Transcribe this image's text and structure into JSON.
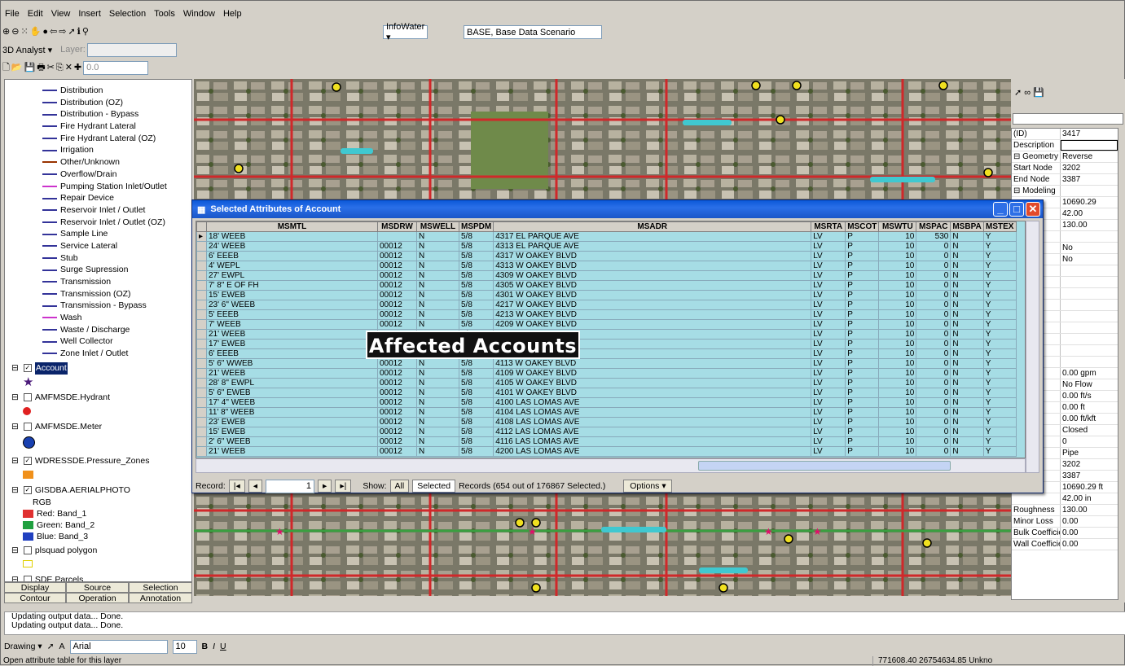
{
  "menu": [
    "File",
    "Edit",
    "View",
    "Insert",
    "Selection",
    "Tools",
    "Window",
    "Help"
  ],
  "toolbar": {
    "infowater": "InfoWater ▾",
    "scenario": "BASE, Base Data Scenario",
    "analyst": "3D Analyst ▾",
    "layer_label": "Layer:",
    "zoom_value": "0.0"
  },
  "toc": {
    "legend": [
      {
        "label": "Distribution",
        "color": "#333399"
      },
      {
        "label": "Distribution (OZ)",
        "color": "#333399"
      },
      {
        "label": "Distribution - Bypass",
        "color": "#333399"
      },
      {
        "label": "Fire Hydrant Lateral",
        "color": "#333399"
      },
      {
        "label": "Fire Hydrant Lateral (OZ)",
        "color": "#333399"
      },
      {
        "label": "Irrigation",
        "color": "#333399"
      },
      {
        "label": "Other/Unknown",
        "color": "#993300"
      },
      {
        "label": "Overflow/Drain",
        "color": "#333399"
      },
      {
        "label": "Pumping Station Inlet/Outlet",
        "color": "#cc33cc"
      },
      {
        "label": "Repair Device",
        "color": "#333399"
      },
      {
        "label": "Reservoir Inlet / Outlet",
        "color": "#333399"
      },
      {
        "label": "Reservoir Inlet / Outlet (OZ)",
        "color": "#333399"
      },
      {
        "label": "Sample Line",
        "color": "#333399"
      },
      {
        "label": "Service Lateral",
        "color": "#333399"
      },
      {
        "label": "Stub",
        "color": "#333399"
      },
      {
        "label": "Surge Supression",
        "color": "#333399"
      },
      {
        "label": "Transmission",
        "color": "#333399"
      },
      {
        "label": "Transmission (OZ)",
        "color": "#333399"
      },
      {
        "label": "Transmission - Bypass",
        "color": "#333399"
      },
      {
        "label": "Wash",
        "color": "#cc33cc"
      },
      {
        "label": "Waste / Discharge",
        "color": "#333399"
      },
      {
        "label": "Well Collector",
        "color": "#333399"
      },
      {
        "label": "Zone Inlet / Outlet",
        "color": "#333399"
      }
    ],
    "layers": {
      "account": "Account",
      "hydrant": "AMFMSDE.Hydrant",
      "meter": "AMFMSDE.Meter",
      "pressure": "WDRESSDE.Pressure_Zones",
      "aerial": "GISDBA.AERIALPHOTO",
      "rgb": "RGB",
      "red": "Red:   Band_1",
      "green": "Green: Band_2",
      "blue": "Blue:  Band_3",
      "plsquad": "plsquad polygon",
      "parcels": "SDE.Parcels"
    },
    "tabs": {
      "display": "Display",
      "source": "Source",
      "selection": "Selection",
      "contour": "Contour",
      "operation": "Operation",
      "annotation": "Annotation"
    }
  },
  "dialog": {
    "title": "Selected Attributes of Account",
    "columns": [
      "MSMTL",
      "MSDRW",
      "MSWELL",
      "MSPDM",
      "MSADR",
      "MSRTA",
      "MSCOT",
      "MSWTU",
      "MSPAC",
      "MSBPA",
      "MSTEX"
    ],
    "rows": [
      [
        "18' WEEB",
        "",
        "N",
        "5/8",
        "4317 EL PARQUE AVE",
        "LV",
        "P",
        "10",
        "530",
        "N",
        "Y"
      ],
      [
        "24' WEEB",
        "00012",
        "N",
        "5/8",
        "4313 EL PARQUE AVE",
        "LV",
        "P",
        "10",
        "0",
        "N",
        "Y"
      ],
      [
        "6' EEEB",
        "00012",
        "N",
        "5/8",
        "4317 W OAKEY BLVD",
        "LV",
        "P",
        "10",
        "0",
        "N",
        "Y"
      ],
      [
        "4' WEPL",
        "00012",
        "N",
        "5/8",
        "4313 W OAKEY BLVD",
        "LV",
        "P",
        "10",
        "0",
        "N",
        "Y"
      ],
      [
        "27' EWPL",
        "00012",
        "N",
        "5/8",
        "4309 W OAKEY BLVD",
        "LV",
        "P",
        "10",
        "0",
        "N",
        "Y"
      ],
      [
        "7' 8\" E OF FH",
        "00012",
        "N",
        "5/8",
        "4305 W OAKEY BLVD",
        "LV",
        "P",
        "10",
        "0",
        "N",
        "Y"
      ],
      [
        "15' EWEB",
        "00012",
        "N",
        "5/8",
        "4301 W OAKEY BLVD",
        "LV",
        "P",
        "10",
        "0",
        "N",
        "Y"
      ],
      [
        "23' 6\" WEEB",
        "00012",
        "N",
        "5/8",
        "4217 W OAKEY BLVD",
        "LV",
        "P",
        "10",
        "0",
        "N",
        "Y"
      ],
      [
        "5' EEEB",
        "00012",
        "N",
        "5/8",
        "4213 W OAKEY BLVD",
        "LV",
        "P",
        "10",
        "0",
        "N",
        "Y"
      ],
      [
        "7' WEEB",
        "00012",
        "N",
        "5/8",
        "4209 W OAKEY BLVD",
        "LV",
        "P",
        "10",
        "0",
        "N",
        "Y"
      ],
      [
        "21' WEEB",
        "00012",
        "N",
        "5/8",
        "",
        "LV",
        "P",
        "10",
        "0",
        "N",
        "Y"
      ],
      [
        "17' EWEB",
        "00012",
        "N",
        "5/8",
        "",
        "LV",
        "P",
        "10",
        "0",
        "N",
        "Y"
      ],
      [
        "6' EEEB",
        "00012",
        "N",
        "5/8",
        "",
        "LV",
        "P",
        "10",
        "0",
        "N",
        "Y"
      ],
      [
        "5' 6\" WWEB",
        "00012",
        "N",
        "5/8",
        "4113 W OAKEY BLVD",
        "LV",
        "P",
        "10",
        "0",
        "N",
        "Y"
      ],
      [
        "21' WEEB",
        "00012",
        "N",
        "5/8",
        "4109 W OAKEY BLVD",
        "LV",
        "P",
        "10",
        "0",
        "N",
        "Y"
      ],
      [
        "28' 8\" EWPL",
        "00012",
        "N",
        "5/8",
        "4105 W OAKEY BLVD",
        "LV",
        "P",
        "10",
        "0",
        "N",
        "Y"
      ],
      [
        "5' 6\" EWEB",
        "00012",
        "N",
        "5/8",
        "4101 W OAKEY BLVD",
        "LV",
        "P",
        "10",
        "0",
        "N",
        "Y"
      ],
      [
        "17' 4\" WEEB",
        "00012",
        "N",
        "5/8",
        "4100 LAS LOMAS AVE",
        "LV",
        "P",
        "10",
        "0",
        "N",
        "Y"
      ],
      [
        "11' 8\" WEEB",
        "00012",
        "N",
        "5/8",
        "4104 LAS LOMAS AVE",
        "LV",
        "P",
        "10",
        "0",
        "N",
        "Y"
      ],
      [
        "23' EWEB",
        "00012",
        "N",
        "5/8",
        "4108 LAS LOMAS AVE",
        "LV",
        "P",
        "10",
        "0",
        "N",
        "Y"
      ],
      [
        "15' EWEB",
        "00012",
        "N",
        "5/8",
        "4112 LAS LOMAS AVE",
        "LV",
        "P",
        "10",
        "0",
        "N",
        "Y"
      ],
      [
        "2' 6\" WEEB",
        "00012",
        "N",
        "5/8",
        "4116 LAS LOMAS AVE",
        "LV",
        "P",
        "10",
        "0",
        "N",
        "Y"
      ],
      [
        "21' WEEB",
        "00012",
        "N",
        "5/8",
        "4200 LAS LOMAS AVE",
        "LV",
        "P",
        "10",
        "0",
        "N",
        "Y"
      ]
    ],
    "record_label": "Record:",
    "record_value": "1",
    "show_label": "Show:",
    "all": "All",
    "selected": "Selected",
    "records_text": "Records  (654 out of 176867 Selected.)",
    "options": "Options ▾"
  },
  "overlay": "Affected Accounts",
  "props": [
    {
      "k": "(ID)",
      "v": "3417"
    },
    {
      "k": "Description",
      "v": ""
    },
    {
      "k": "⊟ Geometry",
      "v": "Reverse"
    },
    {
      "k": "Start Node",
      "v": "3202"
    },
    {
      "k": "End Node",
      "v": "3387"
    },
    {
      "k": "⊟ Modeling",
      "v": ""
    },
    {
      "k": "",
      "v": "10690.29"
    },
    {
      "k": "",
      "v": "42.00"
    },
    {
      "k": "ss",
      "v": "130.00"
    },
    {
      "k": "s",
      "v": ""
    },
    {
      "k": "alize",
      "v": "No"
    },
    {
      "k": "alve",
      "v": "No"
    },
    {
      "k": "etion",
      "v": ""
    },
    {
      "k": "n Ye",
      "v": ""
    },
    {
      "k": "nt Ye",
      "v": ""
    },
    {
      "k": "",
      "v": ""
    },
    {
      "k": "",
      "v": ""
    },
    {
      "k": "",
      "v": ""
    },
    {
      "k": "",
      "v": ""
    },
    {
      "k": "",
      "v": ""
    },
    {
      "k": "",
      "v": ""
    },
    {
      "k": "",
      "v": "0.00 gpm"
    },
    {
      "k": "ction",
      "v": "No Flow"
    },
    {
      "k": "",
      "v": "0.00 ft/s"
    },
    {
      "k": "",
      "v": "0.00 ft"
    },
    {
      "k": "",
      "v": "0.00 ft/kft"
    },
    {
      "k": "",
      "v": "Closed"
    },
    {
      "k": "erse",
      "v": "0"
    },
    {
      "k": "",
      "v": "Pipe"
    },
    {
      "k": "de",
      "v": "3202"
    },
    {
      "k": "",
      "v": "3387"
    },
    {
      "k": "",
      "v": "10690.29 ft"
    },
    {
      "k": "",
      "v": "42.00 in"
    },
    {
      "k": "Roughness",
      "v": "130.00"
    },
    {
      "k": "Minor Loss",
      "v": "0.00"
    },
    {
      "k": "Bulk Coefficie",
      "v": "0.00"
    },
    {
      "k": "Wall Coefficie",
      "v": "0.00"
    }
  ],
  "status_lines": [
    "Updating output data... Done.",
    "Updating output data... Done."
  ],
  "drawing": {
    "label": "Drawing ▾",
    "font": "Arial",
    "size": "10"
  },
  "statusbar": {
    "hint": "Open attribute table for this layer",
    "coords": "771608.40  26754634.85 Unkno"
  }
}
